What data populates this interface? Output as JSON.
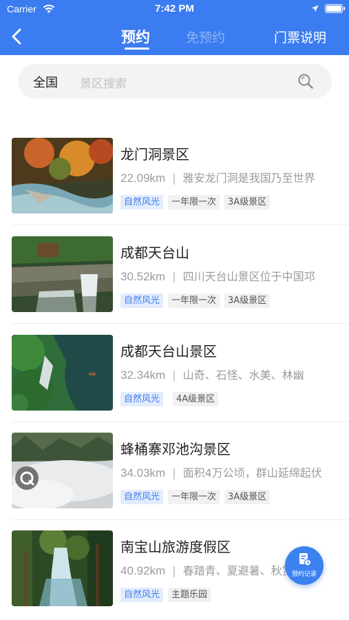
{
  "status_bar": {
    "carrier": "Carrier",
    "time": "7:42 PM"
  },
  "header": {
    "tab_active": "预约",
    "tab_inactive": "免预约",
    "ticket_info": "门票说明"
  },
  "search": {
    "region": "全国",
    "placeholder": "景区搜索"
  },
  "items": [
    {
      "name": "龙门洞景区",
      "distance": "22.09km",
      "desc": "雅安龙门洞是我国乃至世界",
      "tags": [
        "自然风光",
        "一年限一次",
        "3A级景区"
      ]
    },
    {
      "name": "成都天台山",
      "distance": "30.52km",
      "desc": "四川天台山景区位于中国邛",
      "tags": [
        "自然风光",
        "一年限一次",
        "3A级景区"
      ]
    },
    {
      "name": "成都天台山景区",
      "distance": "32.34km",
      "desc": "山奇、石怪、水美、林幽",
      "tags": [
        "自然风光",
        "",
        "4A级景区"
      ]
    },
    {
      "name": "蜂桶寨邓池沟景区",
      "distance": "34.03km",
      "desc": "面积4万公顷，群山延绵起伏",
      "tags": [
        "自然风光",
        "一年限一次",
        "3A级景区"
      ]
    },
    {
      "name": "南宝山旅游度假区",
      "distance": "40.92km",
      "desc": "春踏青、夏避暑、秋赏",
      "tags": [
        "自然风光",
        "主题乐园"
      ]
    }
  ],
  "fab": {
    "label": "预约记录"
  },
  "colors": {
    "primary": "#3b7cf0",
    "tag_bg": "#e3ecfd"
  }
}
